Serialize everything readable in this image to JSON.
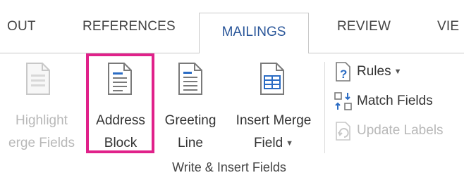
{
  "tabs": [
    {
      "label": "OUT"
    },
    {
      "label": "REFERENCES"
    },
    {
      "label": "MAILINGS"
    },
    {
      "label": "REVIEW"
    },
    {
      "label": "VIE"
    }
  ],
  "active_tab": "MAILINGS",
  "group": {
    "label": "Write & Insert Fields",
    "buttons": [
      {
        "line1": "Highlight",
        "line2": "erge Fields",
        "icon": "document-icon",
        "enabled": false
      },
      {
        "line1": "Address",
        "line2": "Block",
        "icon": "address-block-icon",
        "enabled": true
      },
      {
        "line1": "Greeting",
        "line2": "Line",
        "icon": "greeting-line-icon",
        "enabled": true
      },
      {
        "line1": "Insert Merge",
        "line2": "Field",
        "icon": "insert-merge-field-icon",
        "enabled": true
      }
    ],
    "small_buttons": [
      {
        "label": "Rules",
        "icon": "rules-icon",
        "enabled": true,
        "dropdown": true
      },
      {
        "label": "Match Fields",
        "icon": "match-fields-icon",
        "enabled": true
      },
      {
        "label": "Update Labels",
        "icon": "update-labels-icon",
        "enabled": false
      }
    ]
  },
  "colors": {
    "highlight_border": "#e0218a",
    "active_tab_text": "#2b579a",
    "icon_blue": "#2b6cc4"
  }
}
